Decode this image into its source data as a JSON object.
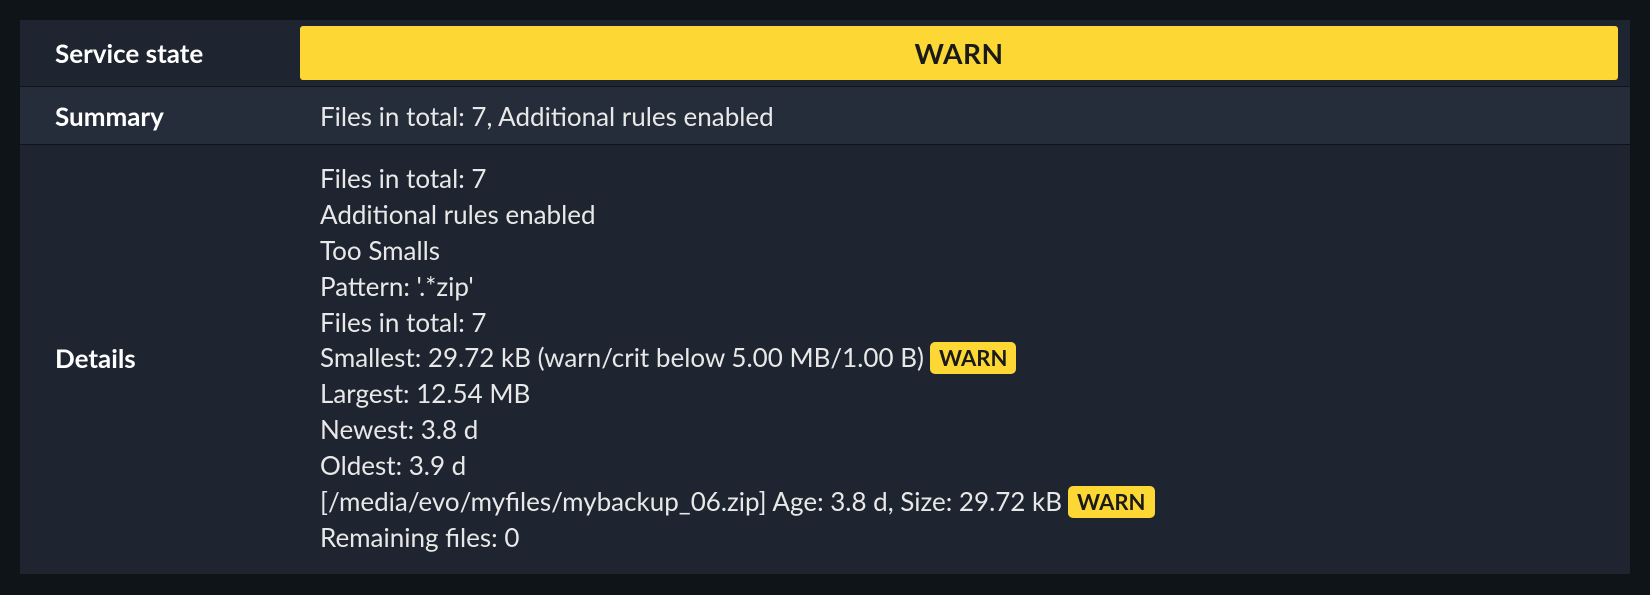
{
  "labels": {
    "service_state": "Service state",
    "summary": "Summary",
    "details": "Details"
  },
  "state": {
    "value": "WARN"
  },
  "summary": "Files in total: 7, Additional rules enabled",
  "details": {
    "lines": [
      {
        "text": "Files in total: 7",
        "badge": null
      },
      {
        "text": "Additional rules enabled",
        "badge": null
      },
      {
        "text": "Too Smalls",
        "badge": null
      },
      {
        "text": "Pattern: '.*zip'",
        "badge": null
      },
      {
        "text": "Files in total: 7",
        "badge": null
      },
      {
        "text": "Smallest: 29.72 kB (warn/crit below 5.00 MB/1.00 B)",
        "badge": "WARN"
      },
      {
        "text": "Largest: 12.54 MB",
        "badge": null
      },
      {
        "text": "Newest: 3.8 d",
        "badge": null
      },
      {
        "text": "Oldest: 3.9 d",
        "badge": null
      },
      {
        "text": "[/media/evo/myfiles/mybackup_06.zip] Age: 3.8 d, Size: 29.72 kB",
        "badge": "WARN"
      },
      {
        "text": "Remaining files: 0",
        "badge": null
      }
    ]
  },
  "colors": {
    "warn": "#fdd835",
    "bg_dark": "#0f1419",
    "bg_row": "#1f2530",
    "bg_row_alt": "#262d3a"
  }
}
